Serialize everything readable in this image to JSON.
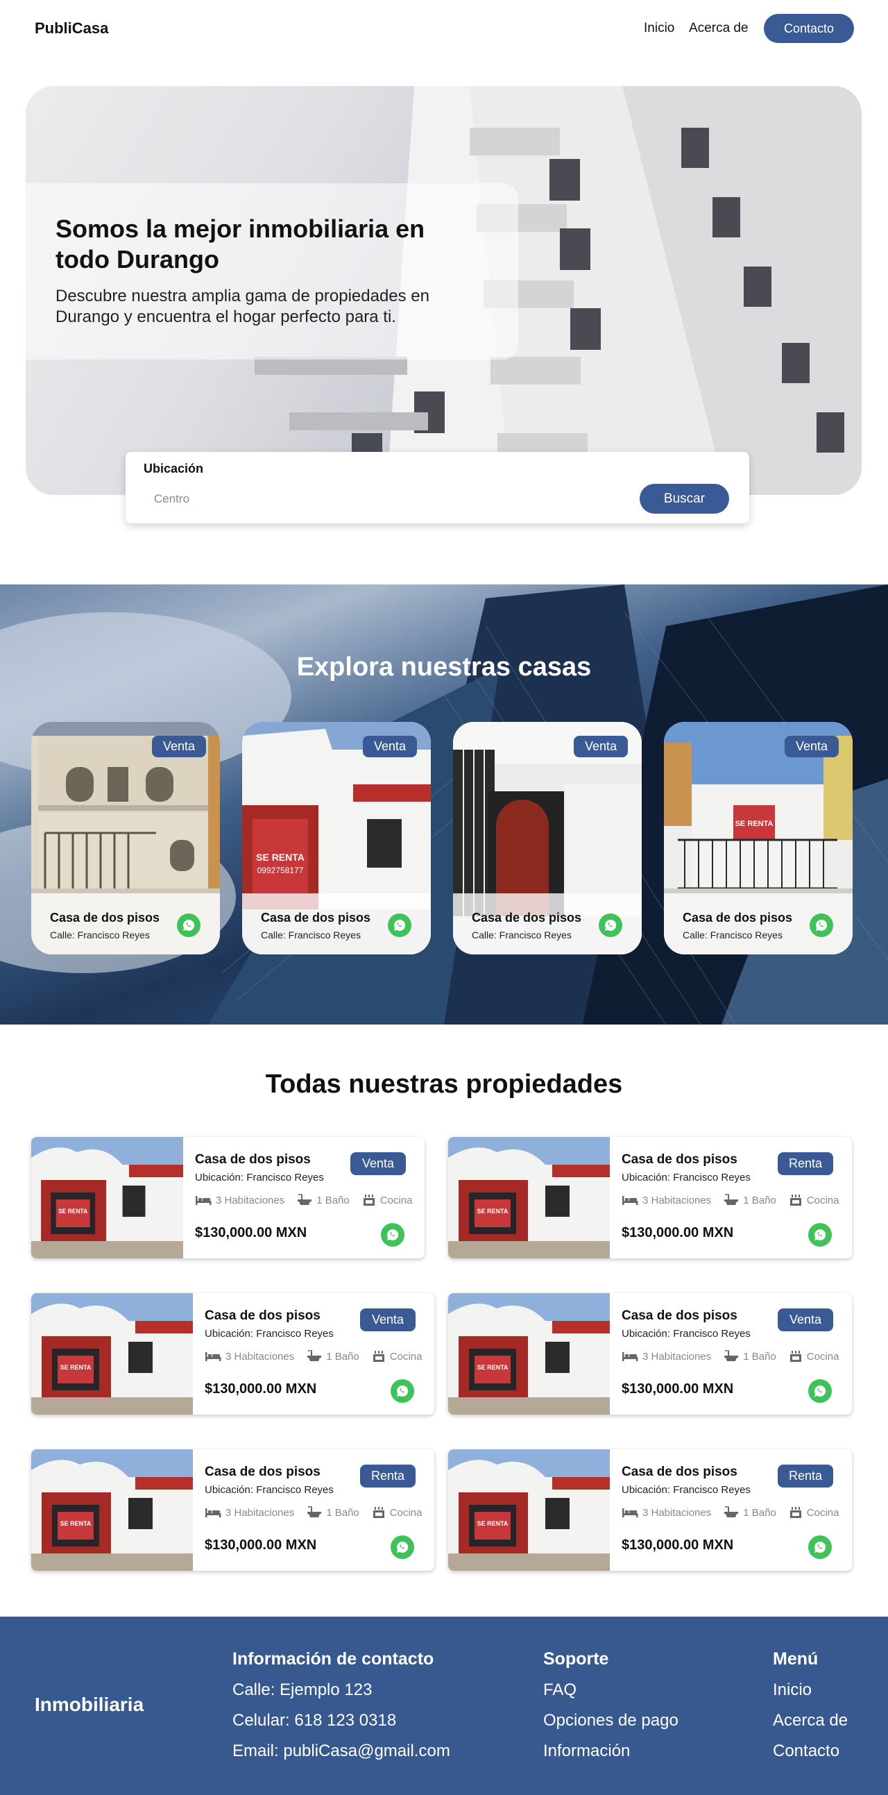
{
  "nav": {
    "brand": "PubliCasa",
    "links": [
      "Inicio",
      "Acerca de"
    ],
    "contact_button": "Contacto"
  },
  "hero": {
    "title": "Somos la mejor inmobiliaria en todo Durango",
    "subtitle": "Descubre nuestra amplia gama de propiedades en Durango y encuentra el hogar perfecto para ti."
  },
  "search": {
    "label": "Ubicación",
    "placeholder": "Centro",
    "button": "Buscar"
  },
  "explore": {
    "title": "Explora nuestras casas",
    "cards": [
      {
        "badge": "Venta",
        "title": "Casa de dos pisos",
        "street": "Calle: Francisco Reyes",
        "icon": "whatsapp-icon"
      },
      {
        "badge": "Venta",
        "title": "Casa de dos pisos",
        "street": "Calle: Francisco Reyes",
        "icon": "whatsapp-icon"
      },
      {
        "badge": "Venta",
        "title": "Casa de dos pisos",
        "street": "Calle: Francisco Reyes",
        "icon": "whatsapp-icon"
      },
      {
        "badge": "Venta",
        "title": "Casa de dos pisos",
        "street": "Calle: Francisco Reyes",
        "icon": "whatsapp-icon"
      }
    ]
  },
  "properties": {
    "title": "Todas nuestras propiedades",
    "items": [
      {
        "title": "Casa de dos pisos",
        "location": "Ubicación: Francisco Reyes",
        "badge": "Venta",
        "rooms": "3 Habitaciones",
        "baths": "1 Baño",
        "kitchen": "Cocina",
        "price": "$130,000.00 MXN"
      },
      {
        "title": "Casa de dos pisos",
        "location": "Ubicación: Francisco Reyes",
        "badge": "Renta",
        "rooms": "3 Habitaciones",
        "baths": "1 Baño",
        "kitchen": "Cocina",
        "price": "$130,000.00 MXN"
      },
      {
        "title": "Casa de dos pisos",
        "location": "Ubicación: Francisco Reyes",
        "badge": "Venta",
        "rooms": "3 Habitaciones",
        "baths": "1 Baño",
        "kitchen": "Cocina",
        "price": "$130,000.00 MXN"
      },
      {
        "title": "Casa de dos pisos",
        "location": "Ubicación: Francisco Reyes",
        "badge": "Venta",
        "rooms": "3 Habitaciones",
        "baths": "1 Baño",
        "kitchen": "Cocina",
        "price": "$130,000.00 MXN"
      },
      {
        "title": "Casa de dos pisos",
        "location": "Ubicación: Francisco Reyes",
        "badge": "Renta",
        "rooms": "3 Habitaciones",
        "baths": "1 Baño",
        "kitchen": "Cocina",
        "price": "$130,000.00 MXN"
      },
      {
        "title": "Casa de dos pisos",
        "location": "Ubicación: Francisco Reyes",
        "badge": "Renta",
        "rooms": "3 Habitaciones",
        "baths": "1 Baño",
        "kitchen": "Cocina",
        "price": "$130,000.00 MXN"
      }
    ]
  },
  "footer": {
    "brand": "Inmobiliaria",
    "contact": {
      "title": "Información de contacto",
      "items": [
        "Calle: Ejemplo 123",
        "Celular: 618 123 0318",
        "Email: publiCasa@gmail.com"
      ]
    },
    "support": {
      "title": "Soporte",
      "items": [
        "FAQ",
        "Opciones de pago",
        "Información"
      ]
    },
    "menu": {
      "title": "Menú",
      "items": [
        "Inicio",
        "Acerca de",
        "Contacto"
      ]
    }
  },
  "colors": {
    "accent": "#3a5a96",
    "footer": "#37598f",
    "whatsapp": "#3fc257"
  }
}
